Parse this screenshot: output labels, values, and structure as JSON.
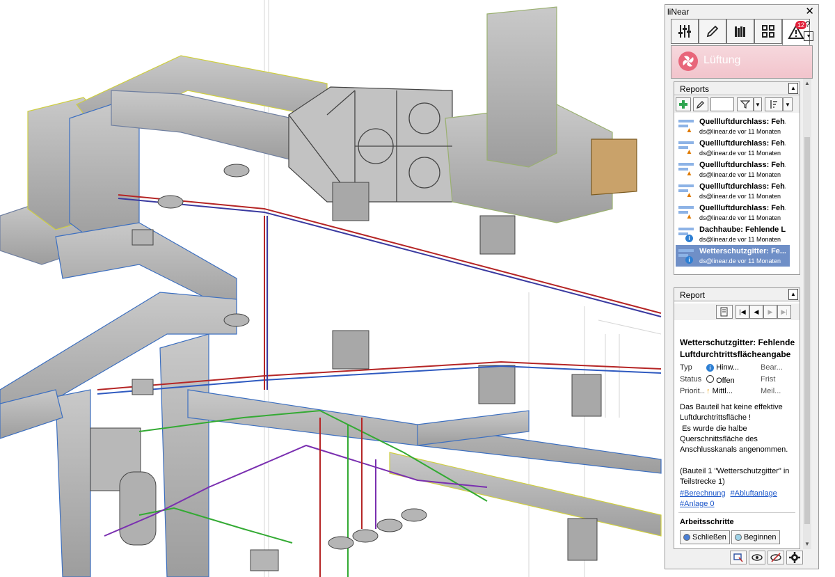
{
  "panel": {
    "title": "liNear",
    "close": "✕",
    "tabs": [
      {
        "icon": "sliders-icon"
      },
      {
        "icon": "pencil-icon"
      },
      {
        "icon": "books-icon"
      },
      {
        "icon": "grid-icon"
      },
      {
        "icon": "warning-icon",
        "badge": "12"
      }
    ],
    "help": "?",
    "header_title": "Lüftung",
    "colors": {
      "header_accent": "#e8667a",
      "selection": "#6f8fc7",
      "link": "#1a55c9",
      "add_green": "#2ea44f"
    }
  },
  "reports": {
    "title": "Reports",
    "items": [
      {
        "title": "Quellluftdurchlass: Feh...",
        "meta": "ds@linear.de vor 11 Monaten",
        "status": "warning"
      },
      {
        "title": "Quellluftdurchlass: Feh...",
        "meta": "ds@linear.de vor 11 Monaten",
        "status": "warning"
      },
      {
        "title": "Quellluftdurchlass: Feh...",
        "meta": "ds@linear.de vor 11 Monaten",
        "status": "warning"
      },
      {
        "title": "Quellluftdurchlass: Feh...",
        "meta": "ds@linear.de vor 11 Monaten",
        "status": "warning"
      },
      {
        "title": "Quellluftdurchlass: Feh...",
        "meta": "ds@linear.de vor 11 Monaten",
        "status": "warning"
      },
      {
        "title": "Dachhaube: Fehlende L...",
        "meta": "ds@linear.de vor 11 Monaten",
        "status": "info"
      },
      {
        "title": "Wetterschutzgitter: Fe...",
        "meta": "ds@linear.de vor 11 Monaten",
        "status": "info",
        "selected": true
      }
    ]
  },
  "report": {
    "title": "Report",
    "heading": "Wetterschutzgitter: Fehlende Luftdurchtrittsflächeangabe",
    "typ_label": "Typ",
    "typ_value": "Hinw...",
    "typ_extra": "Bear...",
    "status_label": "Status",
    "status_value": "Offen",
    "status_extra": "Frist",
    "prio_label": "Priorit...",
    "prio_value": "Mittl...",
    "prio_extra": "Meil...",
    "description": "Das Bauteil hat keine effektive Luftdurchtrittsfläche !\n Es wurde die halbe Querschnittsfläche des Anschlusskanals angenommen.\n\n(Bauteil 1 \"Wetterschutzgitter\" in Teilstrecke 1)",
    "tags": [
      "#Berechnung",
      "#Abluftanlage",
      "#Anlage 0"
    ],
    "steps_title": "Arbeitsschritte",
    "step_close": "Schließen",
    "step_begin": "Beginnen"
  }
}
